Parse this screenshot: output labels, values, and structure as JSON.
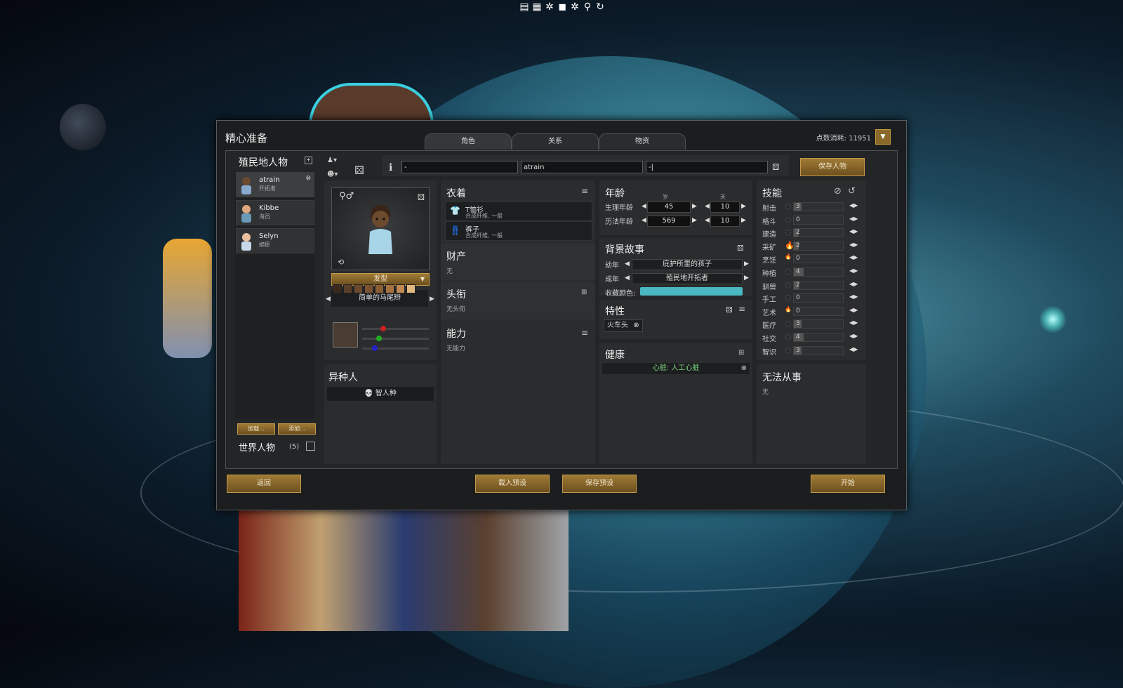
{
  "toolbar": {
    "icons": [
      "list-icon",
      "grid-icon",
      "flower-icon",
      "cube-icon",
      "flower2-icon",
      "search-icon",
      "refresh-icon"
    ]
  },
  "dialog": {
    "title": "精心准备",
    "points_label": "点数消耗: 11951"
  },
  "tabs": [
    {
      "label": "角色"
    },
    {
      "label": "关系"
    },
    {
      "label": "物资"
    }
  ],
  "colonists": {
    "title": "殖民地人物",
    "pawns": [
      {
        "name": "atrain",
        "title": "开拓者"
      },
      {
        "name": "Kibbe",
        "title": "海员"
      },
      {
        "name": "Selyn",
        "title": "嫡臣"
      }
    ],
    "load_btn": "加载...",
    "add_btn": "添加...",
    "world_title": "世界人物",
    "world_count": "(5)"
  },
  "name_fields": {
    "first": "-",
    "nick": "atrain",
    "last": "-|",
    "save_btn": "保存人物"
  },
  "portrait": {
    "hair_btn": "发型",
    "hair_style": "简单的马尾辫",
    "skin_colors": [
      "#3a2a1e",
      "#5a3f2a",
      "#6b4a2e",
      "#7a5431",
      "#8c5e36",
      "#a8703e",
      "#c08a52",
      "#e0b880"
    ],
    "preview_color": "#4a3c30"
  },
  "xeno": {
    "title": "异种人",
    "value": "智人种"
  },
  "apparel": {
    "title": "衣着",
    "items": [
      {
        "name": "T恤衫",
        "desc": "合成纤维, 一般"
      },
      {
        "name": "裤子",
        "desc": "合成纤维, 一般"
      }
    ]
  },
  "possessions": {
    "title": "财产",
    "value": "无"
  },
  "titles": {
    "title": "头衔",
    "value": "无头衔"
  },
  "abilities": {
    "title": "能力",
    "value": "无能力"
  },
  "age": {
    "title": "年龄",
    "unit_year": "岁",
    "unit_day": "天",
    "bio_label": "生理年龄",
    "bio_years": "45",
    "bio_days": "10",
    "chrono_label": "历法年龄",
    "chrono_years": "569",
    "chrono_days": "10"
  },
  "backstory": {
    "title": "背景故事",
    "child_label": "幼年",
    "child_value": "庇护所里的孩子",
    "adult_label": "成年",
    "adult_value": "殖民地开拓者",
    "color_label": "收藏颜色:",
    "fav_color": "#4ab8c0"
  },
  "traits": {
    "title": "特性",
    "items": [
      "火车头"
    ]
  },
  "health": {
    "title": "健康",
    "items": [
      "心脏: 人工心脏"
    ]
  },
  "skills": {
    "title": "技能",
    "rows": [
      {
        "name": "射击",
        "value": "3",
        "passion": 0
      },
      {
        "name": "格斗",
        "value": "0",
        "passion": 0
      },
      {
        "name": "建造",
        "value": "2",
        "passion": 0
      },
      {
        "name": "采矿",
        "value": "2",
        "passion": 2
      },
      {
        "name": "烹饪",
        "value": "0",
        "passion": 1
      },
      {
        "name": "种植",
        "value": "4",
        "passion": 0
      },
      {
        "name": "驯兽",
        "value": "2",
        "passion": 0
      },
      {
        "name": "手工",
        "value": "0",
        "passion": 0
      },
      {
        "name": "艺术",
        "value": "0",
        "passion": 1
      },
      {
        "name": "医疗",
        "value": "3",
        "passion": 0
      },
      {
        "name": "社交",
        "value": "4",
        "passion": 0
      },
      {
        "name": "智识",
        "value": "3",
        "passion": 0
      }
    ]
  },
  "incapable": {
    "title": "无法从事",
    "value": "无"
  },
  "footer": {
    "back": "返回",
    "load_preset": "载入预设",
    "save_preset": "保存预设",
    "start": "开始"
  }
}
